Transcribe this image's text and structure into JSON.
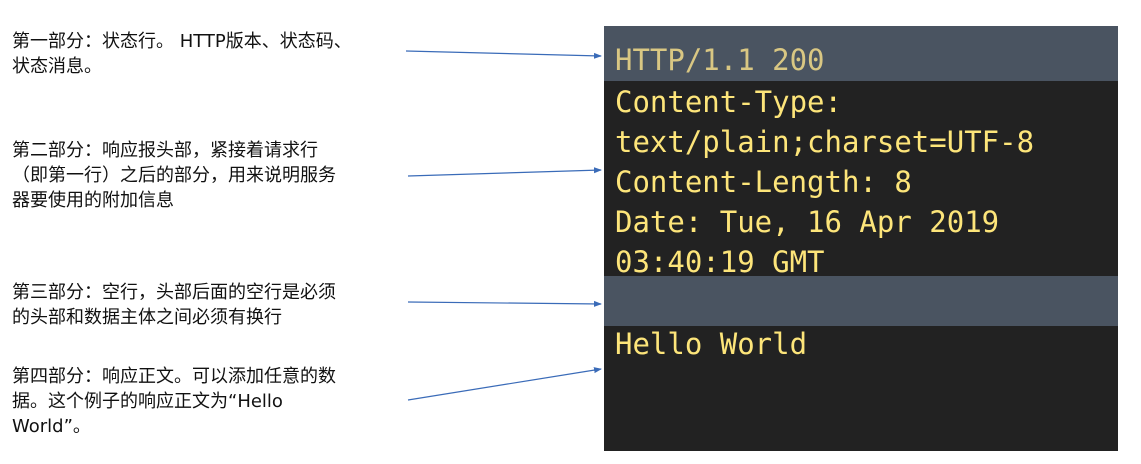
{
  "annotations": [
    {
      "lines": [
        "第一部分：状态行。 HTTP版本、状态码、",
        "状态消息。"
      ]
    },
    {
      "lines": [
        "第二部分：响应报头部，紧接着请求行",
        "（即第一行）之后的部分，用来说明服务",
        "器要使用的附加信息"
      ]
    },
    {
      "lines": [
        "第三部分：空行，头部后面的空行是必须",
        "的头部和数据主体之间必须有换行"
      ]
    },
    {
      "lines": [
        "第四部分：响应正文。可以添加任意的数",
        "据。这个例子的响应正文为“Hello",
        "World”。"
      ]
    }
  ],
  "http_response": {
    "status_line": "HTTP/1.1 200",
    "header_lines": [
      "Content-Type:",
      "text/plain;charset=UTF-8",
      "Content-Length: 8",
      "Date: Tue, 16 Apr 2019",
      "03:40:19 GMT"
    ],
    "body_line": "Hello World"
  },
  "colors": {
    "panel_background": "#222222",
    "highlight_band": "#4a5461",
    "code_text": "#fde57a",
    "arrow": "#3a6bb8"
  }
}
